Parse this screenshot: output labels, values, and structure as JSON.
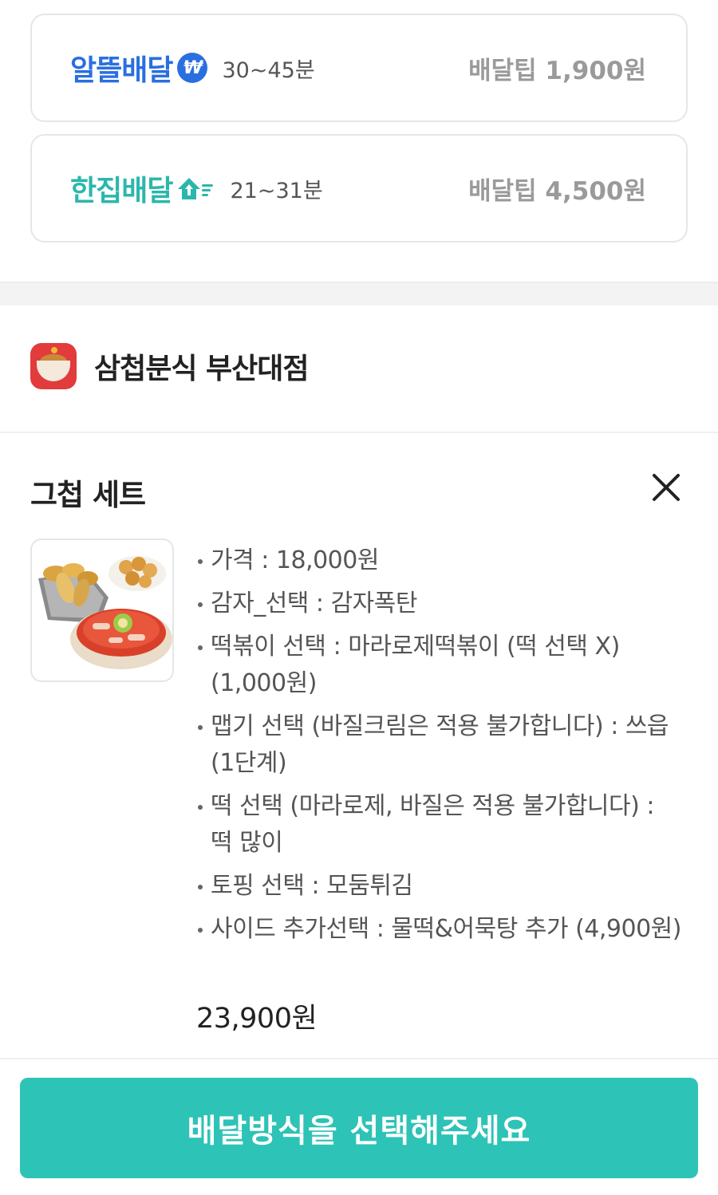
{
  "delivery_options": [
    {
      "brand": "알뜰배달",
      "badge": "₩",
      "eta": "30~45분",
      "tip": "배달팁 1,900원",
      "color": "#2a6fe0",
      "icon": "won-badge-icon"
    },
    {
      "brand": "한집배달",
      "eta": "21~31분",
      "tip": "배달팁 4,500원",
      "color": "#2bb7ac",
      "icon": "home-arrow-icon"
    }
  ],
  "store": {
    "name": "삼첩분식 부산대점",
    "logo_icon": "store-logo-icon"
  },
  "cart_item": {
    "title": "그첩 세트",
    "close_icon": "close-icon",
    "options": [
      "가격 : 18,000원",
      "감자_선택 : 감자폭탄",
      "떡볶이 선택 : 마라로제떡볶이 (떡 선택 X) (1,000원)",
      "맵기 선택 (바질크림은 적용 불가합니다) : 쓰읍 (1단계)",
      "떡 선택 (마라로제, 바질은 적용 불가합니다) : 떡 많이",
      "토핑 선택 : 모둠튀김",
      "사이드 추가선택 : 물떡&어묵탕 추가 (4,900원)"
    ],
    "total": "23,900원"
  },
  "cta": {
    "label": "배달방식을 선택해주세요",
    "color": "#2dc3b6"
  }
}
